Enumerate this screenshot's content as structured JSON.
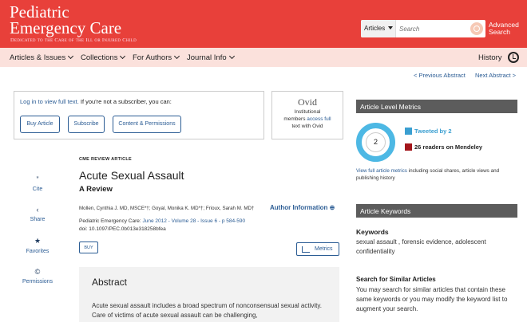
{
  "header": {
    "journal_line1": "Pediatric",
    "journal_line2": "Emergency Care",
    "tagline": "Dedicated to the Care of the Ill or Injured Child",
    "search_scope": "Articles",
    "search_placeholder": "Search",
    "advanced_search_line1": "Advanced",
    "advanced_search_line2": "Search",
    "accent_color": "#e8403a"
  },
  "nav": {
    "items": [
      "Articles & Issues",
      "Collections",
      "For Authors",
      "Journal Info"
    ],
    "history_label": "History"
  },
  "article_nav": {
    "previous": "< Previous Abstract",
    "next": "Next Abstract >"
  },
  "access": {
    "login_link": "Log in to view full text.",
    "not_subscriber": " If you're not a subscriber, you can:",
    "buttons": [
      "Buy Article",
      "Subscribe",
      "Content & Permissions"
    ]
  },
  "ovid": {
    "logo": "Ovid",
    "line1": "Institutional",
    "line2_prefix": "members ",
    "line2_link": "access full",
    "line3": "text with Ovid"
  },
  "tools": [
    {
      "label": "Cite",
      "icon": "quote-icon",
      "glyph": "”"
    },
    {
      "label": "Share",
      "icon": "share-icon",
      "glyph": "‹"
    },
    {
      "label": "Favorites",
      "icon": "star-icon",
      "glyph": "★"
    },
    {
      "label": "Permissions",
      "icon": "permissions-icon",
      "glyph": "©"
    }
  ],
  "article": {
    "type": "CME REVIEW ARTICLE",
    "title": "Acute Sexual Assault",
    "subtitle": "A Review",
    "authors": "Mollen, Cynthia J. MD, MSCE*†; Goyal, Monika K. MD*†; Frioux, Sarah M. MD†",
    "author_info": "Author Information",
    "citation_prefix": "Pediatric Emergency Care: ",
    "citation_link": "June 2012 - Volume 28 - Issue 6 - p 584-590",
    "doi": "doi: 10.1097/PEC.0b013e318258bfea",
    "buy_label": "BUY",
    "metrics_label": "Metrics"
  },
  "abstract": {
    "heading": "Abstract",
    "body": "Acute sexual assault includes a broad spectrum of nonconsensual sexual activity. Care of victims of acute sexual assault can be challenging,"
  },
  "sidebar": {
    "metrics_heading": "Article Level Metrics",
    "altmetric_score": "2",
    "tweeted": "Tweeted by 2",
    "mendeley": "26 readers on Mendeley",
    "metrics_link": "View full article metrics",
    "metrics_note": " including social shares, article views and publishing history",
    "keywords_heading": "Article Keywords",
    "keywords_label": "Keywords",
    "keywords": "sexual assault , forensic evidence, adolescent confidentiality",
    "similar_label": "Search for Similar Articles",
    "similar_text": "You may search for similar articles that contain these same keywords or you may modify the keyword list to augment your search.",
    "tweet_color": "#3a9fd1",
    "mendeley_color": "#a3161b"
  }
}
